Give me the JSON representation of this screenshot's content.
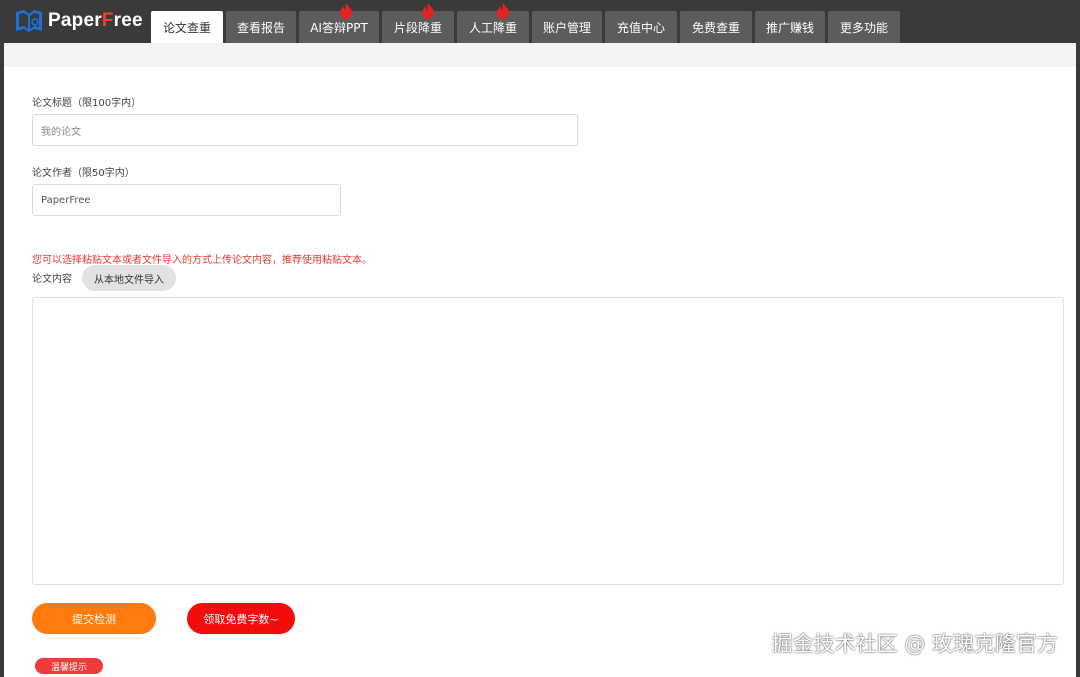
{
  "brand": {
    "name_prefix": "Paper",
    "name_highlight": "F",
    "name_suffix": "ree"
  },
  "tabs": [
    {
      "label": "论文查重",
      "active": true,
      "hot": false
    },
    {
      "label": "查看报告",
      "active": false,
      "hot": false
    },
    {
      "label": "AI答辩PPT",
      "active": false,
      "hot": true
    },
    {
      "label": "片段降重",
      "active": false,
      "hot": true
    },
    {
      "label": "人工降重",
      "active": false,
      "hot": true
    },
    {
      "label": "账户管理",
      "active": false,
      "hot": false
    },
    {
      "label": "充值中心",
      "active": false,
      "hot": false
    },
    {
      "label": "免费查重",
      "active": false,
      "hot": false
    },
    {
      "label": "推广赚钱",
      "active": false,
      "hot": false
    },
    {
      "label": "更多功能",
      "active": false,
      "hot": false
    }
  ],
  "form": {
    "title_label": "论文标题（限100字内）",
    "title_placeholder": "我的论文",
    "author_label": "论文作者（限50字内）",
    "author_value": "PaperFree",
    "tip": "您可以选择粘贴文本或者文件导入的方式上传论文内容，推荐使用粘贴文本。",
    "content_label": "论文内容",
    "import_button": "从本地文件导入"
  },
  "actions": {
    "submit": "提交检测",
    "free_words": "领取免费字数~"
  },
  "notice_badge": "温馨提示",
  "watermark": "掘金技术社区 @ 玫瑰克隆官方",
  "colors": {
    "topbar": "#3a3a3a",
    "tab": "#5c5c5c",
    "orange": "#ff7a0d",
    "red": "#f20c0c",
    "tip": "#e53935"
  }
}
